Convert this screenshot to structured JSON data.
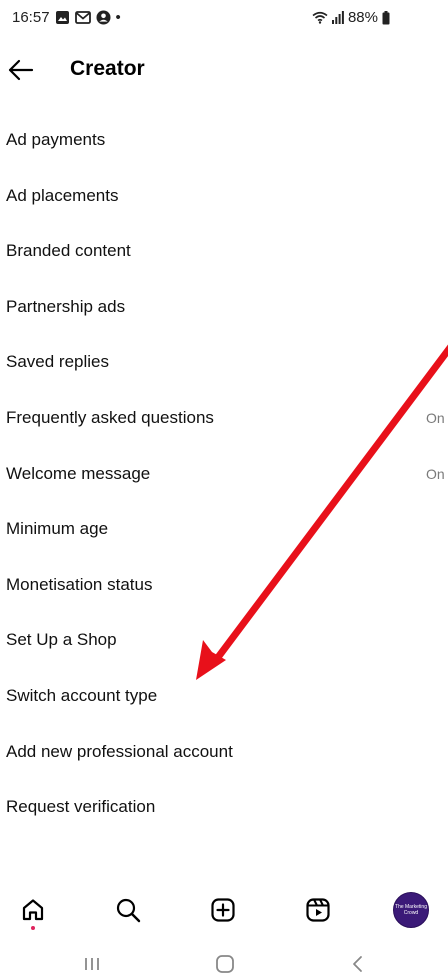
{
  "status_bar": {
    "time": "16:57",
    "dot": "•",
    "battery": "88%",
    "icons": [
      "gallery-icon",
      "gmail-icon",
      "account-icon",
      "wifi-icon",
      "signal-icon",
      "battery-icon"
    ]
  },
  "header": {
    "title": "Creator",
    "back_icon": "arrow-left-icon"
  },
  "menu": {
    "items": [
      {
        "label": "Ad payments",
        "value": ""
      },
      {
        "label": "Ad placements",
        "value": ""
      },
      {
        "label": "Branded content",
        "value": ""
      },
      {
        "label": "Partnership ads",
        "value": ""
      },
      {
        "label": "Saved replies",
        "value": ""
      },
      {
        "label": "Frequently asked questions",
        "value": "On"
      },
      {
        "label": "Welcome message",
        "value": "On"
      },
      {
        "label": "Minimum age",
        "value": ""
      },
      {
        "label": "Monetisation status",
        "value": ""
      },
      {
        "label": "Set Up a Shop",
        "value": ""
      },
      {
        "label": "Switch account type",
        "value": ""
      },
      {
        "label": "Add new professional account",
        "value": ""
      },
      {
        "label": "Request verification",
        "value": ""
      }
    ]
  },
  "annotation": {
    "color": "#e8101a"
  },
  "bottom_nav": {
    "items": [
      "home-icon",
      "search-icon",
      "create-icon",
      "reels-icon",
      "profile-avatar"
    ],
    "avatar_text": "The Marketing Crowd",
    "notification_color": "#e0245e"
  },
  "system_nav": {
    "items": [
      "recents-icon",
      "home-button-icon",
      "back-icon"
    ]
  }
}
